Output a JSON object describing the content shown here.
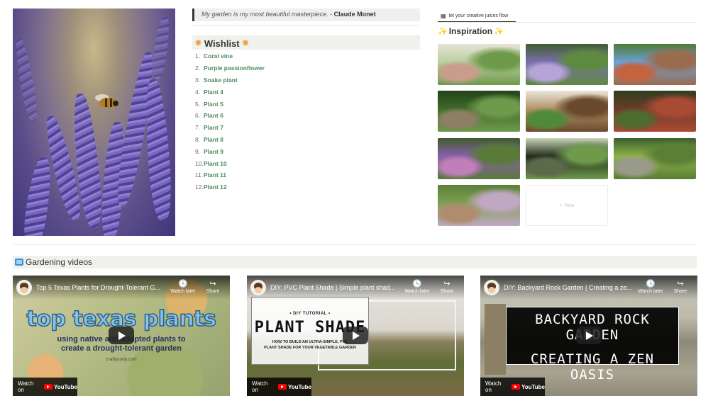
{
  "quote": {
    "text": "My garden is my most beautiful masterpiece.",
    "separator": " - ",
    "author": "Claude Monet"
  },
  "wishlist": {
    "title": "Wishlist",
    "items": [
      {
        "num": "1.",
        "label": "Coral vine"
      },
      {
        "num": "2.",
        "label": "Purple passionflower"
      },
      {
        "num": "3.",
        "label": "Snake plant"
      },
      {
        "num": "4.",
        "label": "Plant 4"
      },
      {
        "num": "5.",
        "label": "Plant 5"
      },
      {
        "num": "6.",
        "label": "Plant 6"
      },
      {
        "num": "7.",
        "label": "Plant 7"
      },
      {
        "num": "8.",
        "label": "Plant 8"
      },
      {
        "num": "9.",
        "label": "Plant 9"
      },
      {
        "num": "10.",
        "label": "Plant 10"
      },
      {
        "num": "11.",
        "label": "Plant 11"
      },
      {
        "num": "12.",
        "label": "Plant 12"
      }
    ]
  },
  "inspiration": {
    "tab_label": "let your creative juices flow",
    "title": "Inspiration",
    "new_label": "New",
    "cards": [
      {
        "palette": [
          "#b9cfa0",
          "#6f9a4b",
          "#c99c8c",
          "#e6e3d4"
        ]
      },
      {
        "palette": [
          "#7a6fb0",
          "#5d8a3f",
          "#b6a3d8",
          "#3f5e2b"
        ]
      },
      {
        "palette": [
          "#6aa3d8",
          "#9a6b4f",
          "#c4633f",
          "#4f7a34"
        ]
      },
      {
        "palette": [
          "#3f6b2b",
          "#6f9a4b",
          "#8c7f63",
          "#24421b"
        ]
      },
      {
        "palette": [
          "#b29366",
          "#6a4a2e",
          "#4f8a3a",
          "#e9e4d8"
        ]
      },
      {
        "palette": [
          "#6e3a2a",
          "#a94b34",
          "#4f6b2e",
          "#2f3f20"
        ]
      },
      {
        "palette": [
          "#8a5fb0",
          "#5a7a3a",
          "#c07fb8",
          "#3d5b2a"
        ]
      },
      {
        "palette": [
          "#1f2a1b",
          "#6f9a4b",
          "#5b6a4a",
          "#c9d4b8"
        ]
      },
      {
        "palette": [
          "#8fb24a",
          "#5a7f35",
          "#9a9a8a",
          "#3b5f2e"
        ]
      },
      {
        "palette": [
          "#7fa053",
          "#c0a7c4",
          "#b08c6f",
          "#5b7f3a"
        ]
      }
    ]
  },
  "videos": {
    "title": "Gardening videos",
    "watch_later": "Watch later",
    "share": "Share",
    "watch_on": "Watch on",
    "youtube": "YouTube",
    "items": [
      {
        "title": "Top 5 Texas Plants for Drought-Tolerant G...",
        "thumb_line1": "top texas plants",
        "thumb_line2": "using native and adapted plants to",
        "thumb_line3": "create a drought-tolerant garden",
        "thumb_line4": "craftycorly.com"
      },
      {
        "title": "DIY: PVC Plant Shade | Simple plant shad...",
        "thumb_line1": "• DIY TUTORIAL •",
        "thumb_line2": "PLANT SHADE",
        "thumb_line3": "HOW TO BUILD AN ULTRA-SIMPLE, PVC",
        "thumb_line4": "PLANT SHADE FOR YOUR VEGETABLE GARDEN"
      },
      {
        "title": "DIY: Backyard Rock Garden | Creating a ze...",
        "thumb_line1": "BACKYARD ROCK GARDEN",
        "thumb_line2": "CREATING A ZEN OASIS"
      }
    ]
  }
}
